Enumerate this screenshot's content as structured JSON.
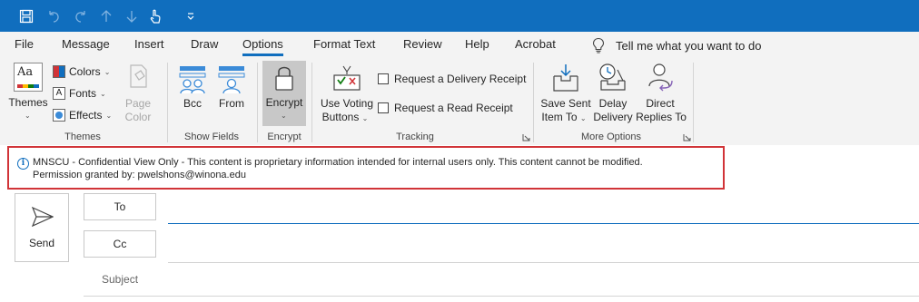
{
  "quick_access": {
    "icons": [
      "save-icon",
      "undo-icon",
      "redo-icon",
      "up-icon",
      "down-icon",
      "touch-mode-icon",
      "customize-icon"
    ]
  },
  "tabs": [
    {
      "label": "File"
    },
    {
      "label": "Message"
    },
    {
      "label": "Insert"
    },
    {
      "label": "Draw"
    },
    {
      "label": "Options",
      "active": true
    },
    {
      "label": "Format Text"
    },
    {
      "label": "Review"
    },
    {
      "label": "Help"
    },
    {
      "label": "Acrobat"
    }
  ],
  "tell_me": {
    "text": "Tell me what you want to do"
  },
  "ribbon": {
    "themes": {
      "themes_label": "Themes",
      "colors_label": "Colors",
      "fonts_label": "Fonts",
      "effects_label": "Effects",
      "page_color_line1": "Page",
      "page_color_line2": "Color",
      "group_label": "Themes"
    },
    "show_fields": {
      "bcc_label": "Bcc",
      "from_label": "From",
      "group_label": "Show Fields"
    },
    "encrypt": {
      "encrypt_label": "Encrypt",
      "group_label": "Encrypt"
    },
    "tracking": {
      "voting_line1": "Use Voting",
      "voting_line2": "Buttons",
      "delivery_receipt": "Request a Delivery Receipt",
      "read_receipt": "Request a Read Receipt",
      "group_label": "Tracking"
    },
    "more_options": {
      "save_sent_line1": "Save Sent",
      "save_sent_line2": "Item To",
      "delay_line1": "Delay",
      "delay_line2": "Delivery",
      "direct_line1": "Direct",
      "direct_line2": "Replies To",
      "group_label": "More Options"
    }
  },
  "infobar": {
    "line1": "MNSCU - Confidential View Only - This content is proprietary information intended for internal users only. This content cannot be modified.",
    "line2": "Permission granted by: pwelshons@winona.edu"
  },
  "compose": {
    "send_label": "Send",
    "to_label": "To",
    "cc_label": "Cc",
    "subject_label": "Subject"
  },
  "colors": {
    "titlebar": "#106ebe",
    "ribbon_bg": "#f3f3f3",
    "infobar_border": "#d13438"
  }
}
